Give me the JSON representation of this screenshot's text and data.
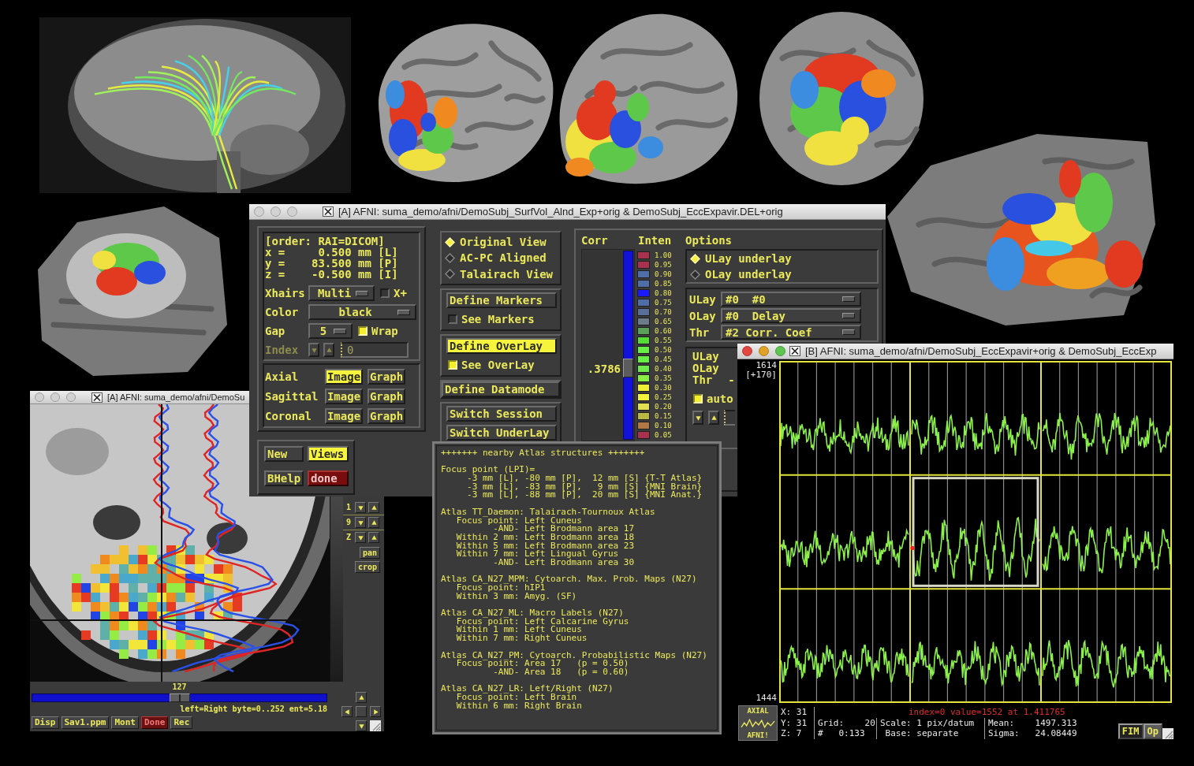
{
  "main_window": {
    "title": "[A] AFNI: suma_demo/afni/DemoSubj_SurfVol_Alnd_Exp+orig & DemoSubj_EccExpavir.DEL+orig",
    "active": false,
    "coordinates": [
      "[order: RAI=DICOM]",
      "x =     0.500 mm [L]",
      "y =    83.500 mm [P]",
      "z =    -0.500 mm [I]"
    ],
    "xhairs": {
      "label": "Xhairs",
      "value": "Multi",
      "toggle": {
        "label": "X+",
        "checked": false
      }
    },
    "color": {
      "label": "Color",
      "value": "black"
    },
    "gap": {
      "label": "Gap",
      "value": "5",
      "toggle": {
        "label": "Wrap",
        "checked": true
      }
    },
    "index": {
      "label": "Index",
      "value": "0",
      "disabled": true
    },
    "views": [
      {
        "label": "Axial",
        "buttons": [
          {
            "label": "Image",
            "on": true
          },
          {
            "label": "Graph",
            "on": false
          }
        ]
      },
      {
        "label": "Sagittal",
        "buttons": [
          {
            "label": "Image",
            "on": false
          },
          {
            "label": "Graph",
            "on": false
          }
        ]
      },
      {
        "label": "Coronal",
        "buttons": [
          {
            "label": "Image",
            "on": false
          },
          {
            "label": "Graph",
            "on": false
          }
        ]
      }
    ],
    "actions": [
      {
        "label": "New",
        "kind": "plain"
      },
      {
        "label": "Views",
        "kind": "lit"
      },
      {
        "label": "BHelp",
        "kind": "plain"
      },
      {
        "label": "done",
        "kind": "quit"
      }
    ],
    "view_modes": [
      {
        "label": "Original View",
        "selected": true
      },
      {
        "label": "AC-PC Aligned",
        "selected": false
      },
      {
        "label": "Talairach View",
        "selected": false
      }
    ],
    "markers": {
      "button": {
        "label": "Define Markers",
        "on": false
      },
      "toggle": {
        "label": "See Markers",
        "checked": false
      }
    },
    "overlay": {
      "button": {
        "label": "Define OverLay",
        "on": true
      },
      "toggle": {
        "label": "See OverLay",
        "checked": true
      }
    },
    "datamode": "Define Datamode",
    "switches": [
      "Switch Session",
      "Switch UnderLay"
    ],
    "columns": [
      "Corr",
      "Inten",
      "Options"
    ],
    "threshold": {
      "reading": ".3786",
      "level": 0.38
    },
    "colorbar": [
      {
        "label": "1.00",
        "color": "#a8324e"
      },
      {
        "label": "0.95",
        "color": "#a8324e"
      },
      {
        "label": "0.90",
        "color": "#4f6ea8"
      },
      {
        "label": "0.85",
        "color": "#4f6ea8"
      },
      {
        "label": "0.80",
        "color": "#1a1aff"
      },
      {
        "label": "0.75",
        "color": "#4f6ea8"
      },
      {
        "label": "0.70",
        "color": "#5a6e9a"
      },
      {
        "label": "0.65",
        "color": "#6d7c8c"
      },
      {
        "label": "0.60",
        "color": "#5aa05a"
      },
      {
        "label": "0.55",
        "color": "#55dd33"
      },
      {
        "label": "0.50",
        "color": "#66ee44"
      },
      {
        "label": "0.45",
        "color": "#66ee44"
      },
      {
        "label": "0.40",
        "color": "#6fe84a"
      },
      {
        "label": "0.35",
        "color": "#88ee44"
      },
      {
        "label": "0.30",
        "color": "#eeee33"
      },
      {
        "label": "0.25",
        "color": "#f2f23a"
      },
      {
        "label": "0.20",
        "color": "#e0e050"
      },
      {
        "label": "0.15",
        "color": "#b8b840"
      },
      {
        "label": "0.10",
        "color": "#b07845"
      },
      {
        "label": "0.05",
        "color": "#a8324e"
      }
    ],
    "underlay_options": [
      {
        "label": "ULay underlay",
        "selected": true
      },
      {
        "label": "OLay underlay",
        "selected": false
      }
    ],
    "layers": [
      {
        "label": "ULay",
        "value": "#0  #0"
      },
      {
        "label": "OLay",
        "value": "#0  Delay"
      },
      {
        "label": "Thr",
        "value": "#2 Corr. Coef"
      }
    ],
    "info": {
      "lines": [
        {
          "label": "ULay"
        },
        {
          "label": "OLay"
        },
        {
          "label": "Thr",
          "value": "-"
        }
      ],
      "auto": {
        "label": "auto",
        "checked": true
      }
    }
  },
  "image_viewer": {
    "title": "[A] AFNI: suma_demo/afni/DemoSu",
    "active": false,
    "steppers": [
      "1",
      "9",
      "Z"
    ],
    "tools": [
      "pan",
      "crop"
    ],
    "slice": {
      "reading": "127",
      "level": 0.5
    },
    "status": "left=Right byte=0..252 ent=5.18",
    "buttons": [
      {
        "label": "Disp",
        "kind": "plain"
      },
      {
        "label": "Sav1.ppm",
        "kind": "plain"
      },
      {
        "label": "Mont",
        "kind": "plain"
      },
      {
        "label": "Done",
        "kind": "quit"
      },
      {
        "label": "Rec",
        "kind": "plain"
      }
    ]
  },
  "atlas_window": {
    "header": "+++++++ nearby Atlas structures +++++++",
    "blocks": [
      {
        "kind": "coordinates",
        "heading": "Focus point (LPI)=",
        "lines": [
          {
            "text": "-3 mm [L], -80 mm [P],  12 mm [S] {T-T Atlas}"
          },
          {
            "text": "-3 mm [L], -83 mm [P],   9 mm [S] {MNI Brain}"
          },
          {
            "text": "-3 mm [L], -88 mm [P],  20 mm [S] {MNI Anat.}"
          }
        ]
      },
      {
        "kind": "atlas",
        "heading": "Atlas TT_Daemon: Talairach-Tournoux Atlas",
        "lines": [
          {
            "text": "Focus point: Left Cuneus",
            "children": [
              {
                "text": "-AND- Left Brodmann area 17"
              }
            ]
          },
          {
            "text": "Within 2 mm: Left Brodmann area 18"
          },
          {
            "text": "Within 5 mm: Left Brodmann area 23"
          },
          {
            "text": "Within 7 mm: Left Lingual Gyrus",
            "children": [
              {
                "text": "-AND- Left Brodmann area 30"
              }
            ]
          }
        ]
      },
      {
        "kind": "atlas",
        "heading": "Atlas CA_N27_MPM: Cytoarch. Max. Prob. Maps (N27)",
        "lines": [
          {
            "text": "Focus point: hIP1"
          },
          {
            "text": "Within 3 mm: Amyg. (SF)"
          }
        ]
      },
      {
        "kind": "atlas",
        "heading": "Atlas CA_N27_ML: Macro Labels (N27)",
        "lines": [
          {
            "text": "Focus point: Left Calcarine Gyrus"
          },
          {
            "text": "Within 1 mm: Left Cuneus"
          },
          {
            "text": "Within 7 mm: Right Cuneus"
          }
        ]
      },
      {
        "kind": "atlas",
        "heading": "Atlas CA_N27_PM: Cytoarch. Probabilistic Maps (N27)",
        "lines": [
          {
            "text": "Focus point: Area 17   (p = 0.50)",
            "children": [
              {
                "text": "-AND- Area 18   (p = 0.60)"
              }
            ]
          }
        ]
      },
      {
        "kind": "atlas",
        "heading": "Atlas CA_N27_LR: Left/Right (N27)",
        "lines": [
          {
            "text": "Focus point: Left Brain"
          },
          {
            "text": "Within 6 mm: Right Brain"
          }
        ]
      }
    ]
  },
  "graph_window": {
    "title": "[B] AFNI: suma_demo/afni/DemoSubj_EccExpavir+orig & DemoSubj_EccExp",
    "active": true,
    "top_value": "1614",
    "range": "[+170]",
    "bottom_value": "1444",
    "logo": [
      "AXIAL",
      "AFNI!"
    ],
    "coords": [
      "X: 31",
      "Y: 31",
      "Z: 7"
    ],
    "grid": [
      "Grid:    20",
      "#   0:133"
    ],
    "scale": [
      "Scale: 1 pix/datum",
      "Base: separate"
    ],
    "stats": [
      "Mean:    1497.313",
      "Sigma:   24.08449"
    ],
    "readout": "index=0 value=1552 at 1.411765",
    "buttons": [
      "FIM",
      "Op"
    ]
  }
}
